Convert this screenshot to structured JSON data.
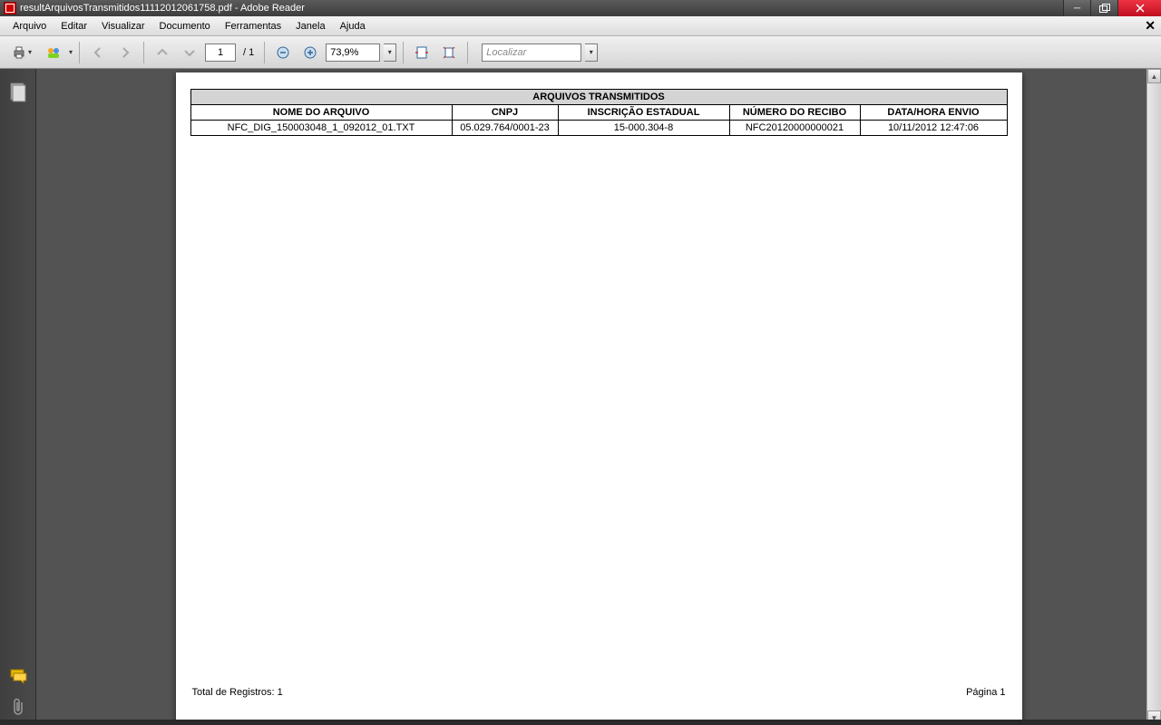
{
  "window": {
    "title": "resultArquivosTransmitidos11112012061758.pdf - Adobe Reader"
  },
  "menu": {
    "arquivo": "Arquivo",
    "editar": "Editar",
    "visualizar": "Visualizar",
    "documento": "Documento",
    "ferramentas": "Ferramentas",
    "janela": "Janela",
    "ajuda": "Ajuda"
  },
  "toolbar": {
    "page_current": "1",
    "page_total": "/ 1",
    "zoom": "73,9%",
    "find_placeholder": "Localizar"
  },
  "pdf": {
    "title": "ARQUIVOS TRANSMITIDOS",
    "headers": {
      "nome": "NOME DO ARQUIVO",
      "cnpj": "CNPJ",
      "inscricao": "INSCRIÇÃO ESTADUAL",
      "recibo": "NÚMERO DO RECIBO",
      "datahora": "DATA/HORA ENVIO"
    },
    "row": {
      "nome": "NFC_DIG_150003048_1_092012_01.TXT",
      "cnpj": "05.029.764/0001-23",
      "inscricao": "15-000.304-8",
      "recibo": "NFC20120000000021",
      "datahora": "10/11/2012 12:47:06"
    },
    "footer_left": "Total de Registros: 1",
    "footer_right": "Página  1"
  }
}
